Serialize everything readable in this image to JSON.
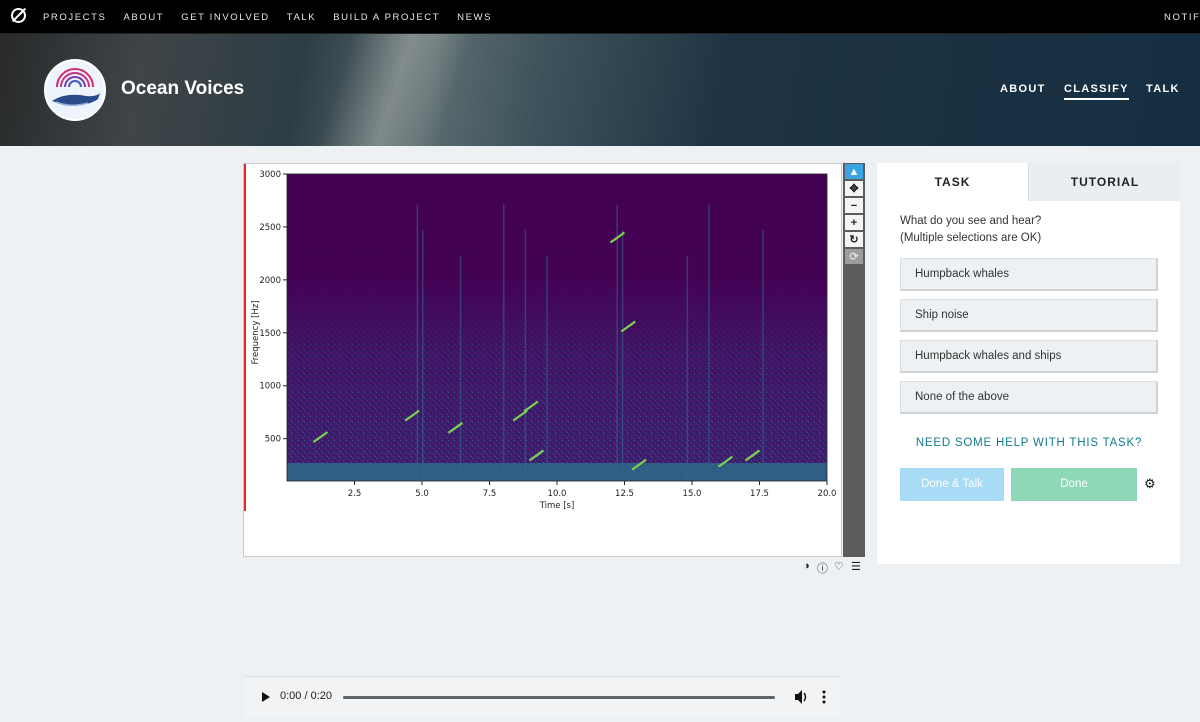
{
  "topnav": {
    "items": [
      "PROJECTS",
      "ABOUT",
      "GET INVOLVED",
      "TALK",
      "BUILD A PROJECT",
      "NEWS"
    ],
    "notifications_label": "NOTIFI"
  },
  "project": {
    "title": "Ocean Voices",
    "nav": [
      "ABOUT",
      "CLASSIFY",
      "TALK"
    ],
    "active_nav": "CLASSIFY"
  },
  "spectrogram": {
    "chart_data": {
      "type": "heatmap",
      "xlabel": "Time [s]",
      "ylabel": "Frequency [Hz]",
      "xlim": [
        0,
        20
      ],
      "ylim": [
        100,
        3000
      ],
      "xticks": [
        "2.5",
        "5.0",
        "7.5",
        "10.0",
        "12.5",
        "15.0",
        "17.5",
        "20.0"
      ],
      "yticks": [
        "500",
        "1000",
        "1500",
        "2000",
        "2500",
        "3000"
      ],
      "colormap": "viridis",
      "background_color": "#440154"
    }
  },
  "audio": {
    "time": "0:00 / 0:20"
  },
  "toolbar": {
    "tools": [
      "pointer-icon",
      "move-icon",
      "zoom-out-icon",
      "zoom-in-icon",
      "rotate-icon",
      "reset-icon"
    ]
  },
  "task": {
    "tabs": [
      "TASK",
      "TUTORIAL"
    ],
    "question_line1": "What do you see and hear?",
    "question_line2": "(Multiple selections are OK)",
    "answers": [
      "Humpback whales",
      "Ship noise",
      "Humpback whales and ships",
      "None of the above"
    ],
    "help": "NEED SOME HELP WITH THIS TASK?",
    "done_talk": "Done & Talk",
    "done": "Done"
  },
  "colors": {
    "accent_blue": "#3aa4e4",
    "done_green": "#8ed8b7",
    "done_talk_blue": "#a8dbf5",
    "help_link": "#127a8f"
  }
}
